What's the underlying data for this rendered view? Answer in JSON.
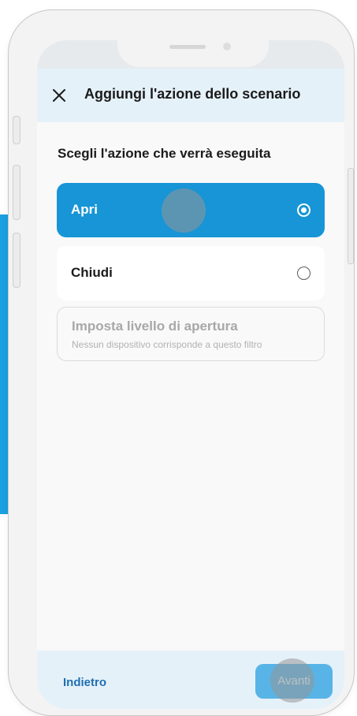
{
  "header": {
    "title": "Aggiungi l'azione dello scenario",
    "close_icon": "close-icon"
  },
  "section": {
    "title": "Scegli l'azione che verrà eseguita"
  },
  "options": [
    {
      "label": "Apri",
      "selected": true
    },
    {
      "label": "Chiudi",
      "selected": false
    },
    {
      "label": "Imposta livello di apertura",
      "subtitle": "Nessun dispositivo corrisponde a questo filtro",
      "disabled": true
    }
  ],
  "footer": {
    "back_label": "Indietro",
    "next_label": "Avanti"
  },
  "colors": {
    "accent": "#1795d6",
    "header_bg": "#e5f1f9",
    "link": "#1e6fb0",
    "next_button": "#58b4e6"
  }
}
